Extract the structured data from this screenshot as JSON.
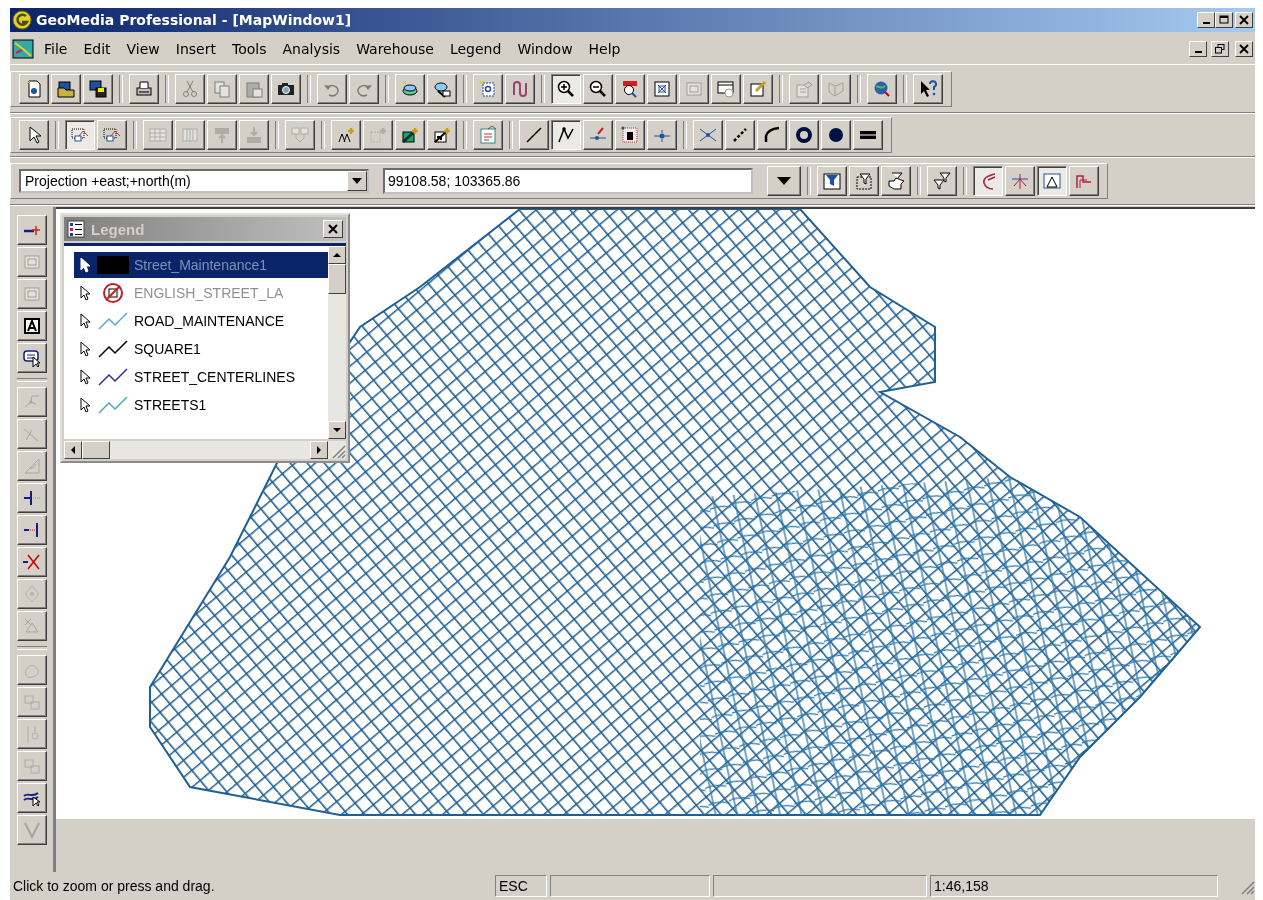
{
  "window": {
    "title": "GeoMedia Professional - [MapWindow1]"
  },
  "menu_bar": {
    "items": [
      "File",
      "Edit",
      "View",
      "Insert",
      "Tools",
      "Analysis",
      "Warehouse",
      "Legend",
      "Window",
      "Help"
    ]
  },
  "toolbars": [
    {
      "groups": [
        [
          {
            "pressed": false,
            "disabled": false
          },
          {
            "pressed": false,
            "disabled": false
          },
          {
            "pressed": false,
            "disabled": false
          }
        ],
        [
          {
            "pressed": false,
            "disabled": false
          }
        ],
        [
          {
            "pressed": false,
            "disabled": true
          },
          {
            "pressed": false,
            "disabled": true
          },
          {
            "pressed": false,
            "disabled": true
          },
          {
            "pressed": false,
            "disabled": false
          }
        ],
        [
          {
            "pressed": false,
            "disabled": true
          },
          {
            "pressed": false,
            "disabled": true
          }
        ],
        [
          {
            "pressed": false,
            "disabled": false
          },
          {
            "pressed": false,
            "disabled": false
          }
        ],
        [
          {
            "pressed": false,
            "disabled": false
          },
          {
            "pressed": false,
            "disabled": false
          }
        ],
        [
          {
            "pressed": true,
            "disabled": false
          },
          {
            "pressed": false,
            "disabled": false
          },
          {
            "pressed": false,
            "disabled": false
          },
          {
            "pressed": false,
            "disabled": false
          },
          {
            "pressed": false,
            "disabled": true
          },
          {
            "pressed": false,
            "disabled": false
          },
          {
            "pressed": false,
            "disabled": false
          }
        ],
        [
          {
            "pressed": false,
            "disabled": true
          },
          {
            "pressed": false,
            "disabled": true
          }
        ],
        [
          {
            "pressed": false,
            "disabled": false
          }
        ],
        [
          {
            "pressed": false,
            "disabled": false
          }
        ]
      ]
    },
    {
      "groups": [
        [
          {
            "pressed": false,
            "disabled": false
          }
        ],
        [
          {
            "pressed": true,
            "disabled": false
          },
          {
            "pressed": false,
            "disabled": false
          }
        ],
        [
          {
            "pressed": false,
            "disabled": true
          },
          {
            "pressed": false,
            "disabled": true
          },
          {
            "pressed": false,
            "disabled": true
          },
          {
            "pressed": false,
            "disabled": true
          }
        ],
        [
          {
            "pressed": false,
            "disabled": true
          }
        ],
        [
          {
            "pressed": false,
            "disabled": false
          },
          {
            "pressed": false,
            "disabled": true
          },
          {
            "pressed": false,
            "disabled": false
          },
          {
            "pressed": false,
            "disabled": false
          }
        ],
        [
          {
            "pressed": false,
            "disabled": false
          }
        ],
        [
          {
            "pressed": false,
            "disabled": false
          },
          {
            "pressed": true,
            "disabled": false
          },
          {
            "pressed": false,
            "disabled": false
          },
          {
            "pressed": false,
            "disabled": false
          },
          {
            "pressed": false,
            "disabled": false
          }
        ],
        [
          {
            "pressed": false,
            "disabled": false
          },
          {
            "pressed": false,
            "disabled": false
          },
          {
            "pressed": false,
            "disabled": false
          },
          {
            "pressed": false,
            "disabled": false
          },
          {
            "pressed": false,
            "disabled": false
          },
          {
            "pressed": false,
            "disabled": false
          }
        ]
      ]
    },
    {
      "projection_select": {
        "value": "Projection +east;+north(m)"
      },
      "coordinate_field": {
        "value": "99108.58; 103365.86"
      },
      "groups": [
        [
          {
            "pressed": false,
            "disabled": false
          },
          {
            "pressed": false,
            "disabled": false
          },
          {
            "pressed": false,
            "disabled": false
          }
        ],
        [
          {
            "pressed": false,
            "disabled": false
          }
        ],
        [
          {
            "pressed": true,
            "disabled": false
          },
          {
            "pressed": false,
            "disabled": false
          },
          {
            "pressed": true,
            "disabled": false
          },
          {
            "pressed": false,
            "disabled": false
          }
        ]
      ]
    }
  ],
  "side_toolbar": {
    "groups": [
      [
        {
          "pressed": false,
          "disabled": false
        },
        {
          "pressed": false,
          "disabled": true
        },
        {
          "pressed": false,
          "disabled": true
        },
        {
          "pressed": false,
          "disabled": false
        },
        {
          "pressed": false,
          "disabled": false
        }
      ],
      [
        {
          "pressed": false,
          "disabled": true
        },
        {
          "pressed": false,
          "disabled": true
        },
        {
          "pressed": false,
          "disabled": true
        },
        {
          "pressed": false,
          "disabled": false
        },
        {
          "pressed": false,
          "disabled": false
        },
        {
          "pressed": false,
          "disabled": false
        },
        {
          "pressed": false,
          "disabled": true
        },
        {
          "pressed": false,
          "disabled": true
        }
      ],
      [
        {
          "pressed": false,
          "disabled": true
        },
        {
          "pressed": false,
          "disabled": true
        },
        {
          "pressed": false,
          "disabled": true
        },
        {
          "pressed": false,
          "disabled": true
        },
        {
          "pressed": false,
          "disabled": false
        },
        {
          "pressed": false,
          "disabled": true
        }
      ]
    ]
  },
  "legend": {
    "title": "Legend",
    "items": [
      {
        "label": "Street_Maintenance1",
        "kind": "fill",
        "color": "#000000",
        "selected": true,
        "visible": false
      },
      {
        "label": "ENGLISH_STREET_LA",
        "kind": "label",
        "selected": false,
        "visible": false
      },
      {
        "label": "ROAD_MAINTENANCE",
        "kind": "line",
        "color": "#5aa8d8",
        "selected": false,
        "visible": true
      },
      {
        "label": "SQUARE1",
        "kind": "line",
        "color": "#000000",
        "selected": false,
        "visible": true
      },
      {
        "label": "STREET_CENTERLINES",
        "kind": "line",
        "color": "#303080",
        "selected": false,
        "visible": true
      },
      {
        "label": "STREETS1",
        "kind": "line",
        "color": "#4aaab8",
        "selected": false,
        "visible": true
      }
    ]
  },
  "status_bar": {
    "message": "Click to zoom or press and drag.",
    "key": "ESC",
    "scale": "1:46,158"
  }
}
